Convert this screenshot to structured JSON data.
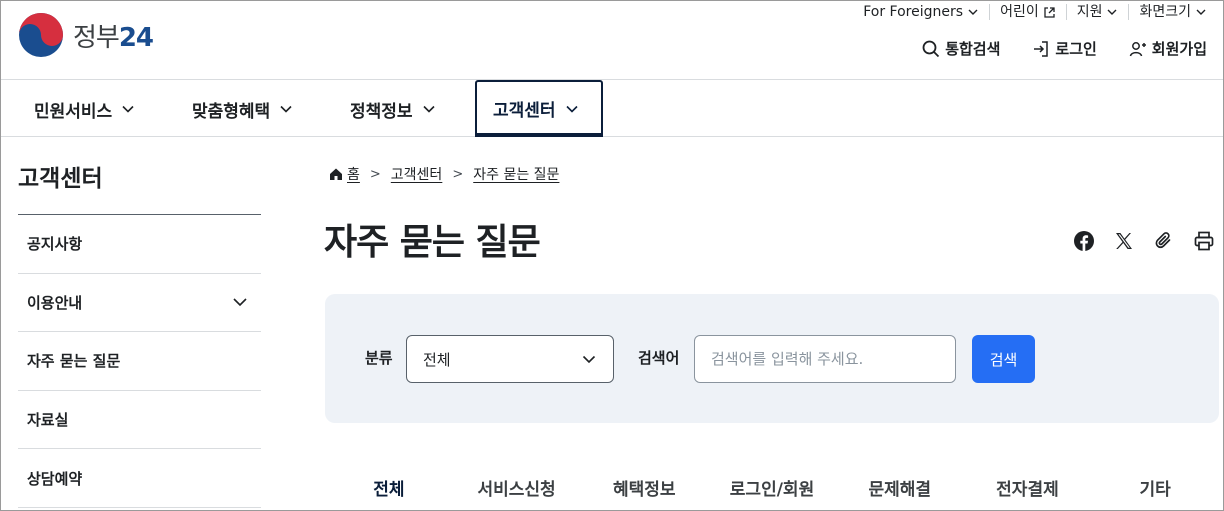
{
  "brand": {
    "name": "정부",
    "number": "24"
  },
  "utility": [
    {
      "label": "For Foreigners",
      "icon": "chevron-down-icon"
    },
    {
      "label": "어린이",
      "icon": "external-link-icon"
    },
    {
      "label": "지원",
      "icon": "chevron-down-icon"
    },
    {
      "label": "화면크기",
      "icon": "chevron-down-icon"
    }
  ],
  "actions": {
    "search": "통합검색",
    "login": "로그인",
    "signup": "회원가입"
  },
  "gnb": [
    "민원서비스",
    "맞춤형혜택",
    "정책정보",
    "고객센터"
  ],
  "lnb": {
    "title": "고객센터",
    "items": [
      "공지사항",
      "이용안내",
      "자주 묻는 질문",
      "자료실",
      "상담예약"
    ]
  },
  "breadcrumb": [
    "홈",
    "고객센터",
    "자주 묻는 질문"
  ],
  "page_title": "자주 묻는 질문",
  "search": {
    "category_label": "분류",
    "category_value": "전체",
    "keyword_label": "검색어",
    "keyword_placeholder": "검색어를 입력해 주세요.",
    "button": "검색"
  },
  "tabs": [
    "전체",
    "서비스신청",
    "혜택정보",
    "로그인/회원",
    "문제해결",
    "전자결제",
    "기타"
  ],
  "colors": {
    "primary": "#256ef4",
    "navy": "#0b1e3a",
    "panel": "#eef2f7"
  }
}
